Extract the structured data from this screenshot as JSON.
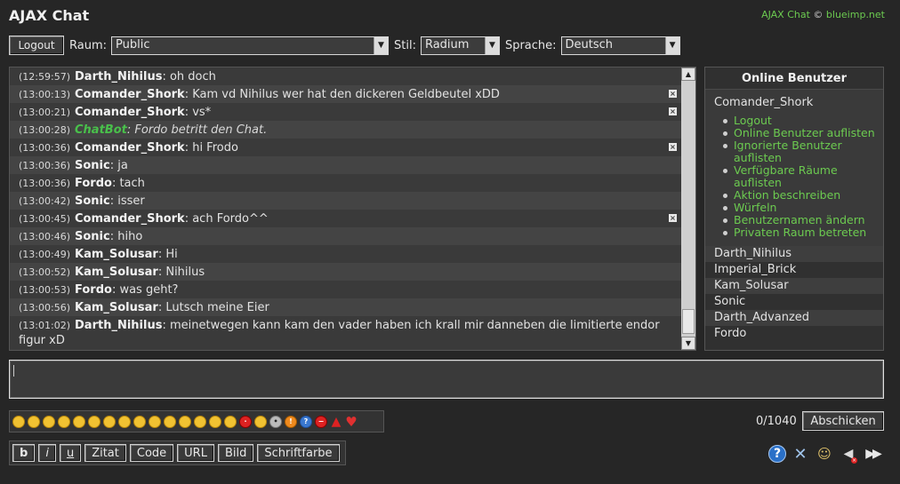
{
  "header": {
    "title": "AJAX Chat",
    "credit_app": "AJAX Chat",
    "credit_sep": "©",
    "credit_vendor": "blueimp.net"
  },
  "toolbar": {
    "logout_label": "Logout",
    "room_label": "Raum:",
    "room_value": "Public",
    "style_label": "Stil:",
    "style_value": "Radium",
    "lang_label": "Sprache:",
    "lang_value": "Deutsch"
  },
  "messages": [
    {
      "time": "(12:59:57)",
      "user": "Darth_Nihilus",
      "text": "oh doch",
      "deletable": false,
      "bot": false
    },
    {
      "time": "(13:00:13)",
      "user": "Comander_Shork",
      "text": "Kam vd Nihilus wer hat den dickeren Geldbeutel xDD",
      "deletable": true,
      "bot": false
    },
    {
      "time": "(13:00:21)",
      "user": "Comander_Shork",
      "text": "vs*",
      "deletable": true,
      "bot": false
    },
    {
      "time": "(13:00:28)",
      "user": "ChatBot",
      "text": "Fordo betritt den Chat.",
      "deletable": false,
      "bot": true
    },
    {
      "time": "(13:00:36)",
      "user": "Comander_Shork",
      "text": "hi Frodo",
      "deletable": true,
      "bot": false
    },
    {
      "time": "(13:00:36)",
      "user": "Sonic",
      "text": "ja",
      "deletable": false,
      "bot": false
    },
    {
      "time": "(13:00:36)",
      "user": "Fordo",
      "text": "tach",
      "deletable": false,
      "bot": false
    },
    {
      "time": "(13:00:42)",
      "user": "Sonic",
      "text": "isser",
      "deletable": false,
      "bot": false
    },
    {
      "time": "(13:00:45)",
      "user": "Comander_Shork",
      "text": "ach Fordo^^",
      "deletable": true,
      "bot": false
    },
    {
      "time": "(13:00:46)",
      "user": "Sonic",
      "text": "hiho",
      "deletable": false,
      "bot": false
    },
    {
      "time": "(13:00:49)",
      "user": "Kam_Solusar",
      "text": "Hi",
      "deletable": false,
      "bot": false
    },
    {
      "time": "(13:00:52)",
      "user": "Kam_Solusar",
      "text": "Nihilus",
      "deletable": false,
      "bot": false
    },
    {
      "time": "(13:00:53)",
      "user": "Fordo",
      "text": "was geht?",
      "deletable": false,
      "bot": false
    },
    {
      "time": "(13:00:56)",
      "user": "Kam_Solusar",
      "text": "Lutsch meine Eier",
      "deletable": false,
      "bot": false
    },
    {
      "time": "(13:01:02)",
      "user": "Darth_Nihilus",
      "text": "meinetwegen kann kam den vader haben ich krall mir danneben die limitierte endor figur xD",
      "deletable": false,
      "bot": false
    }
  ],
  "online": {
    "title": "Online Benutzer",
    "self": "Comander_Shork",
    "menu": [
      "Logout",
      "Online Benutzer auflisten",
      "Ignorierte Benutzer auflisten",
      "Verfügbare Räume auflisten",
      "Aktion beschreiben",
      "Würfeln",
      "Benutzernamen ändern",
      "Privaten Raum betreten"
    ],
    "users": [
      "Darth_Nihilus",
      "Imperial_Brick",
      "Kam_Solusar",
      "Sonic",
      "Darth_Advanzed",
      "Fordo"
    ]
  },
  "input": {
    "counter": "0/1040",
    "send_label": "Abschicken"
  },
  "emoticons": [
    "smile-icon",
    "sad-icon",
    "wink-icon",
    "tongue-icon",
    "grin-icon",
    "neutral-icon",
    "surprised-icon",
    "blush-icon",
    "nerd-icon",
    "glasses-icon",
    "cool-icon",
    "laugh-icon",
    "cry-icon",
    "shock-icon",
    "happy-icon",
    "devil-icon",
    "monkey-icon",
    "idea-icon",
    "exclamation-icon",
    "question-icon",
    "stop-icon",
    "warning-icon",
    "heart-icon"
  ],
  "format": {
    "bold": "b",
    "italic": "i",
    "underline": "u",
    "quote": "Zitat",
    "code": "Code",
    "url": "URL",
    "image": "Bild",
    "color": "Schriftfarbe"
  },
  "colors": {
    "accent_green": "#6ccb50",
    "background": "#262626",
    "panel": "#3a3a3a"
  }
}
